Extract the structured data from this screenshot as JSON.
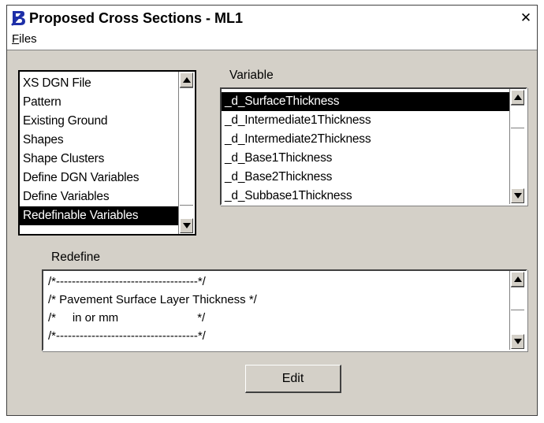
{
  "window": {
    "title": "Proposed Cross Sections - ML1",
    "close_glyph": "✕"
  },
  "menu": {
    "files_label_first": "F",
    "files_label_rest": "iles"
  },
  "category_list": {
    "items": [
      "XS DGN File",
      "Pattern",
      "Existing Ground",
      "Shapes",
      "Shape Clusters",
      "Define DGN Variables",
      "Define Variables",
      "Redefinable Variables"
    ],
    "selected": "Redefinable Variables"
  },
  "variable_section": {
    "label": "Variable",
    "items": [
      "_d_SurfaceThickness",
      "_d_Intermediate1Thickness",
      "_d_Intermediate2Thickness",
      "_d_Base1Thickness",
      "_d_Base2Thickness",
      "_d_Subbase1Thickness"
    ],
    "selected": "_d_SurfaceThickness"
  },
  "redefine_section": {
    "label": "Redefine",
    "lines": [
      "/*------------------------------------*/",
      "/* Pavement Surface Layer Thickness */",
      "/*     in or mm                        */",
      "/*------------------------------------*/"
    ]
  },
  "edit_button": {
    "label": "Edit"
  },
  "icons": {
    "logo": "bentley-logo-icon",
    "close": "close-icon",
    "scroll_up": "scroll-up-arrow-icon",
    "scroll_down": "scroll-down-arrow-icon"
  },
  "colors": {
    "dialog_face": "#d4d0c8",
    "selection": "#000000",
    "logo_blue": "#1e2fa8"
  }
}
